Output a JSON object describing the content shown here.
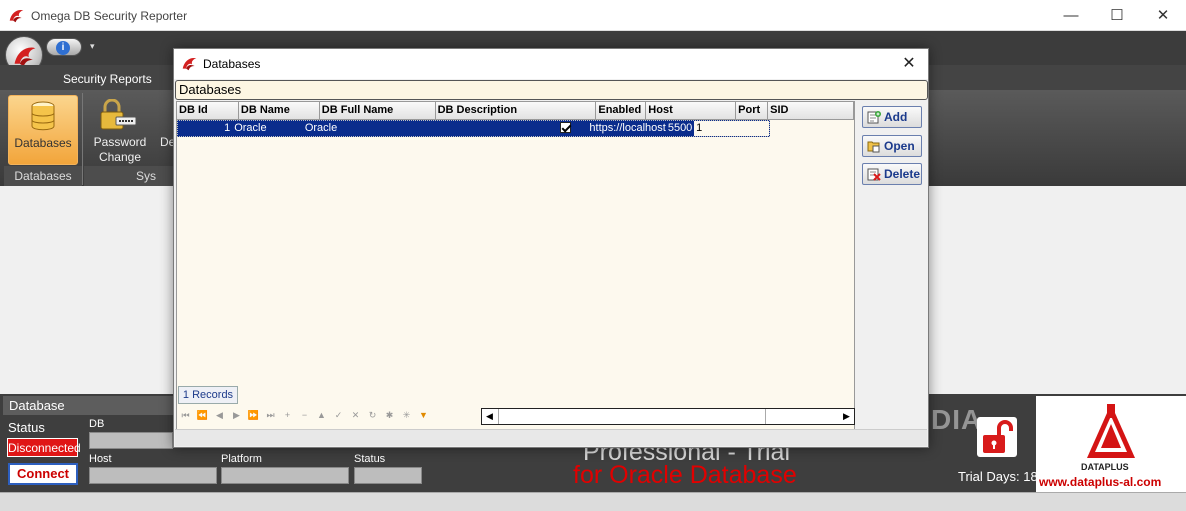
{
  "app": {
    "title": "Omega DB Security Reporter"
  },
  "window_controls": {
    "minimize": "—",
    "maximize": "☐",
    "close": "✕"
  },
  "ribbon": {
    "info_glyph": "i",
    "qat_arrow": "▾",
    "tab": "Security Reports",
    "buttons": {
      "databases": "Databases",
      "password_change": "Password Change",
      "partial": "De"
    },
    "groups": {
      "databases": "Databases",
      "system": "Sys"
    }
  },
  "dialog": {
    "title": "Databases",
    "close": "✕",
    "panel_header": "Databases",
    "columns": [
      "DB Id",
      "DB Name",
      "DB Full Name",
      "DB Description",
      "Enabled",
      "Host",
      "Port",
      "SID"
    ],
    "rows": [
      {
        "db_id": "1",
        "db_name": "Oracle",
        "db_full_name": "Oracle",
        "db_description": "",
        "enabled": true,
        "host": "https://localhost:5",
        "port": "5500",
        "sid": "1"
      }
    ],
    "records": "1 Records",
    "buttons": {
      "add": "Add",
      "open": "Open",
      "delete": "Delete"
    }
  },
  "bottom": {
    "database_header": "Database",
    "status_label": "Status",
    "status_value": "Disconnected",
    "connect": "Connect",
    "fields": {
      "db": "DB",
      "host": "Host",
      "platform": "Platform",
      "status": "Status"
    },
    "banner_line1": "Professional - Trial",
    "banner_line2": "for Oracle Database",
    "watermark": "SOFTPEDIA",
    "trial_days": "Trial Days: 18",
    "logo_word": "DATAPLUS",
    "logo_url": "www.dataplus-al.com"
  },
  "colors": {
    "accent_orange": "#f2a53b",
    "selected_row": "#0a2c8c",
    "disconnected": "#e01616",
    "brand_red": "#c00000"
  }
}
